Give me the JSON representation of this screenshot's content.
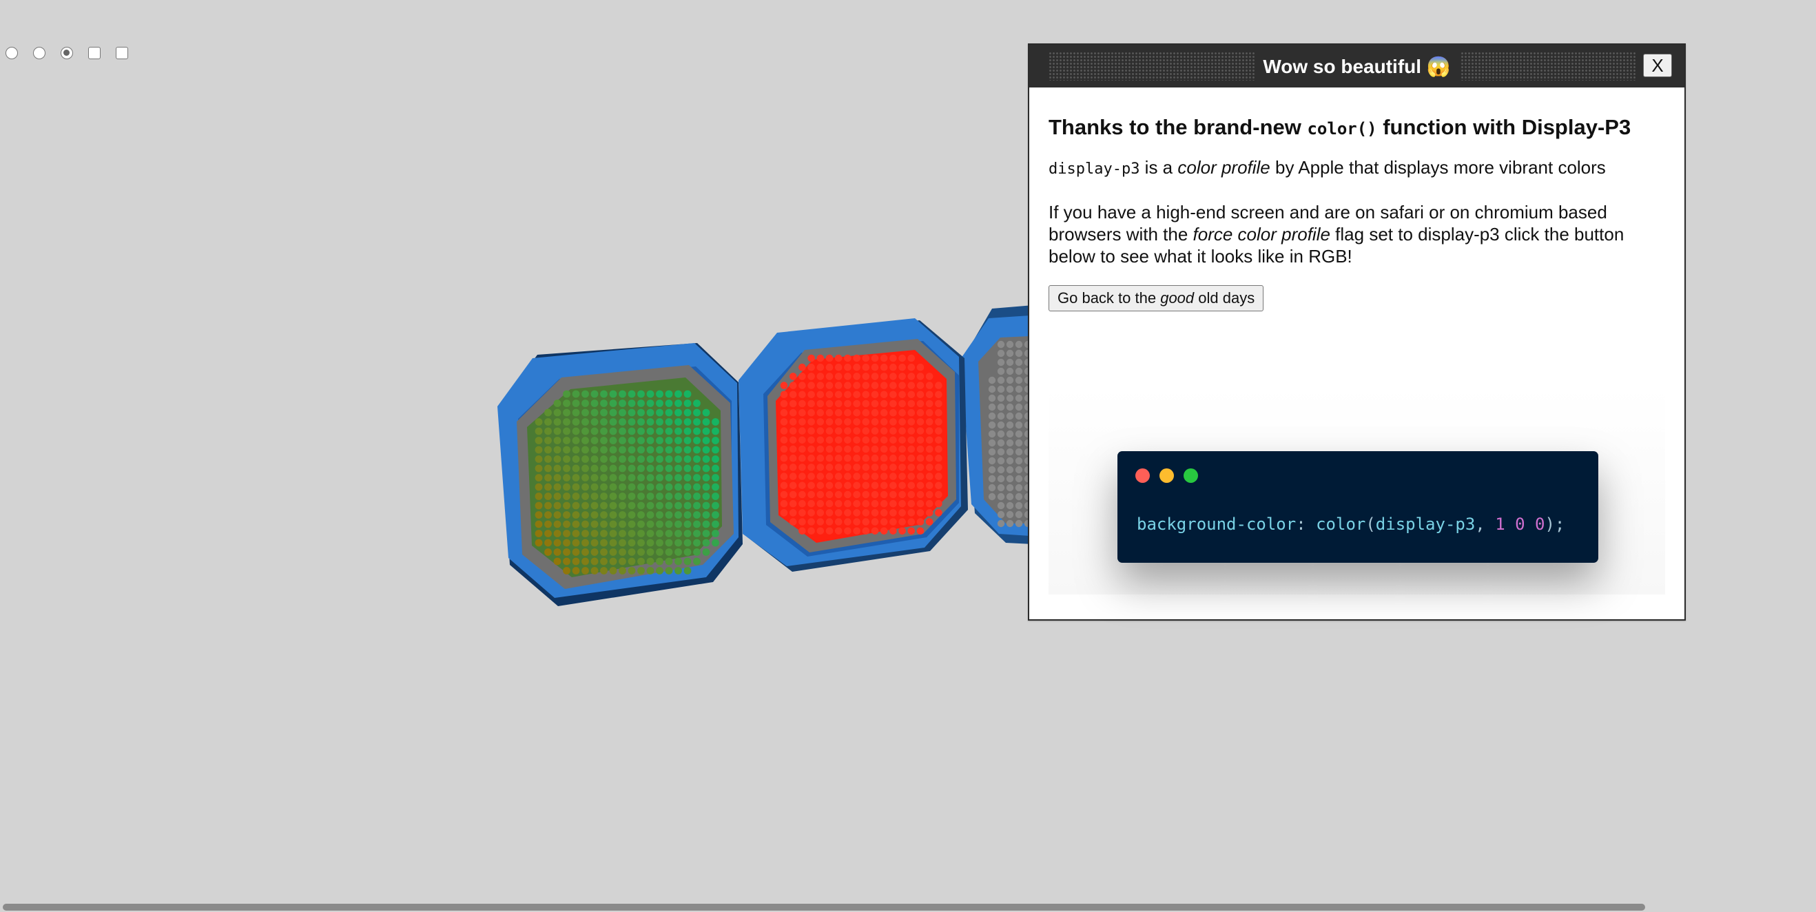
{
  "controls": [
    {
      "type": "radio",
      "checked": false
    },
    {
      "type": "radio",
      "checked": false
    },
    {
      "type": "radio",
      "checked": true
    },
    {
      "type": "checkbox",
      "checked": false
    },
    {
      "type": "checkbox",
      "checked": false
    }
  ],
  "scene": {
    "lights": [
      {
        "name": "green",
        "inner": "#1f9a4e",
        "colors": [
          "#a06d00",
          "#1fae5a"
        ]
      },
      {
        "name": "red",
        "inner": "#ff1f10",
        "colors": [
          "#ff2a14",
          "#ff2a14"
        ]
      },
      {
        "name": "off",
        "inner": "#6e6e6e",
        "colors": [
          "#6a6a6a",
          "#6a6a6a"
        ]
      }
    ],
    "housing_color": "#2f7bd0"
  },
  "window": {
    "title": "Wow so beautiful 😱",
    "close_label": "X",
    "heading_before": "Thanks to the brand-new ",
    "heading_code": "color()",
    "heading_after": " function with Display-P3",
    "para1_code": "display-p3",
    "para1_a": " is a ",
    "para1_em": "color profile",
    "para1_b": " by Apple that displays more vibrant colors",
    "para2_a": "If you have a high-end screen and are on safari or on chromium based browsers with the ",
    "para2_em": "force color profile",
    "para2_b": " flag set to display-p3 click the button below to see what it looks like in RGB!",
    "button_a": "Go back to the ",
    "button_em": "good",
    "button_b": " old days"
  },
  "code_card": {
    "dot_colors": [
      "#ff5f57",
      "#febc2e",
      "#28c840"
    ],
    "code_property": "background-color",
    "code_colon": ": ",
    "code_fn": "color",
    "code_open": "(",
    "code_arg": "display-p3",
    "code_comma": ", ",
    "code_nums": "1 0 0",
    "code_close": ");",
    "colors": {
      "property": "#7ad3e6",
      "fn": "#7ad3e6",
      "number": "#d070d0",
      "punct": "#a9c7d6"
    }
  }
}
